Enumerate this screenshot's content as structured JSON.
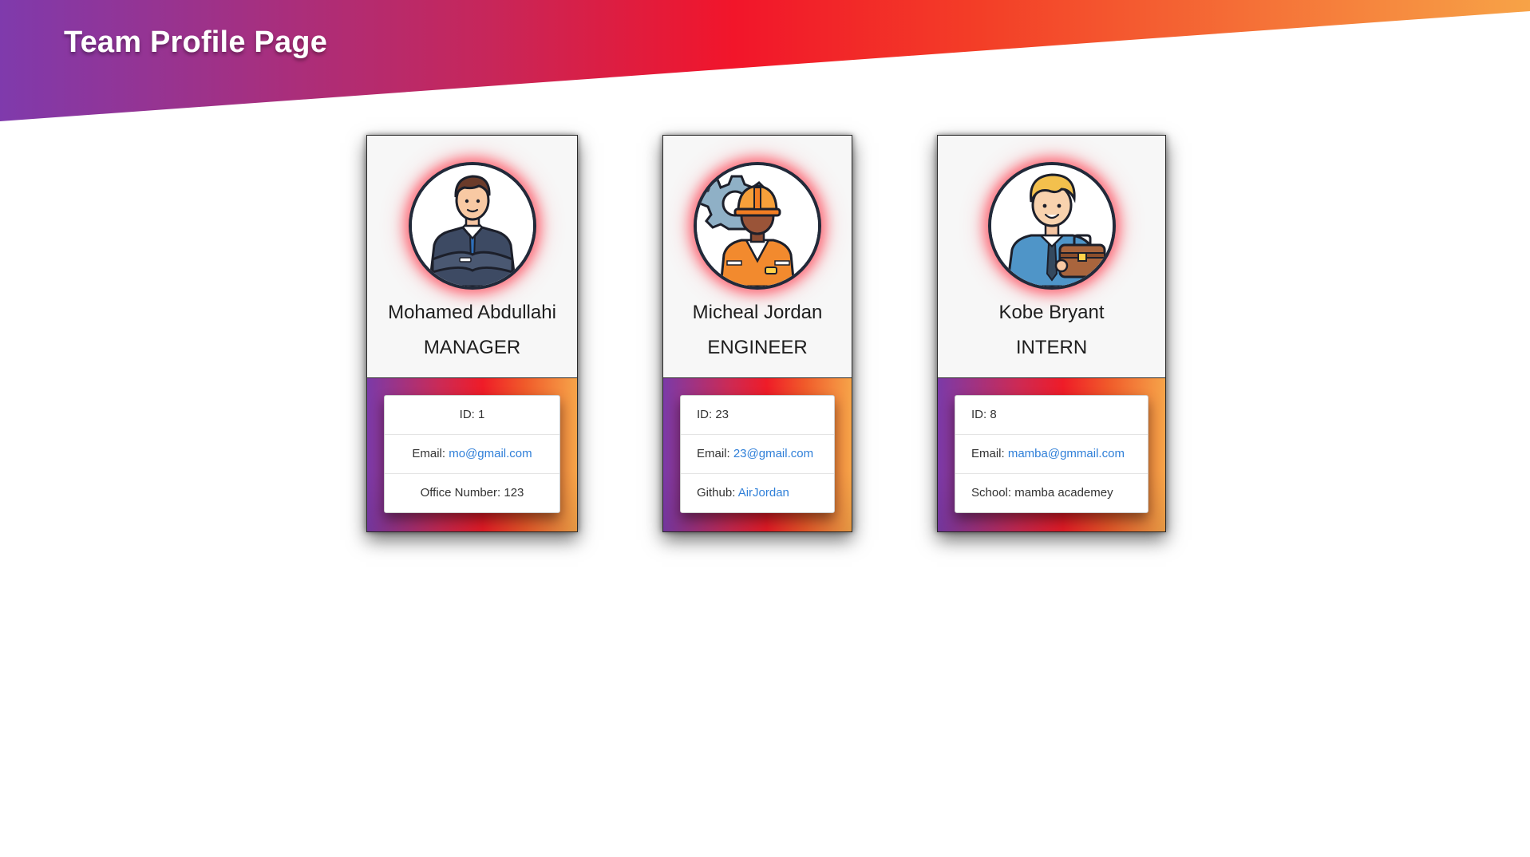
{
  "page": {
    "title": "Team Profile Page"
  },
  "colors": {
    "banner_gradient": [
      "#7f3aac",
      "#c7265a",
      "#f2152a",
      "#f33e27",
      "#f7a347"
    ],
    "link": "#2f7fd8",
    "avatar_glow": "#ff2838"
  },
  "employees": [
    {
      "icon": "manager-avatar-icon",
      "name": "Mohamed Abdullahi",
      "role": "MANAGER",
      "id_label": "ID: ",
      "id": "1",
      "email_label": "Email: ",
      "email": "mo@gmail.com",
      "extra_label": "Office Number: ",
      "extra_value": "123"
    },
    {
      "icon": "engineer-avatar-icon",
      "name": "Micheal Jordan",
      "role": "ENGINEER",
      "id_label": "ID: ",
      "id": "23",
      "email_label": "Email: ",
      "email": "23@gmail.com",
      "extra_label": "Github: ",
      "extra_value": "AirJordan"
    },
    {
      "icon": "intern-avatar-icon",
      "name": "Kobe Bryant",
      "role": "INTERN",
      "id_label": "ID: ",
      "id": "8",
      "email_label": "Email: ",
      "email": "mamba@gmmail.com",
      "extra_label": "School: ",
      "extra_value": "mamba academey"
    }
  ]
}
